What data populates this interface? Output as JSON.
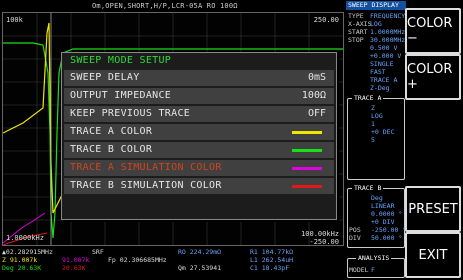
{
  "topbar": {
    "title": "Om,OPEN,SHORT,H/P,LCR-05A  RO 100Ω"
  },
  "plot": {
    "y_top_left": "100k",
    "y_top_right": "250.00",
    "y_bottom_left": "1.0000kHz",
    "y_bottom_right_1": "100.00kHz",
    "y_bottom_right_2": "-250.00"
  },
  "readout": {
    "line1_a": "▲02.282915MHz",
    "line1_b": "SRF",
    "line1_c": "RO 224.29mΩ",
    "line1_d": "R1 104.77kΩ",
    "line2_a": "Z  91.007k",
    "line2_b": "91.007k",
    "line2_c": "Fp 02.306685MHz",
    "line2_d": "L1 262.54uH",
    "line3_a": "Deg  20.63K",
    "line3_b": "20.63K",
    "line3_c": "Qm 27.53941",
    "line3_d": "C1 18.43pF"
  },
  "info": {
    "header": "SWEEP DISPLAY",
    "rows": [
      {
        "k": "TYPE",
        "v": "FREQUENCY"
      },
      {
        "k": "X-AXIS",
        "v": "LOG"
      },
      {
        "k": "START",
        "v": "1.0000MHz"
      },
      {
        "k": "STOP",
        "v": "30.000MHz"
      },
      {
        "k": "",
        "v": "0.500 V"
      },
      {
        "k": "",
        "v": "+0.000 V"
      },
      {
        "k": "",
        "v": "SINGLE"
      },
      {
        "k": "",
        "v": "FAST"
      },
      {
        "k": "",
        "v": "TRACE A"
      },
      {
        "k": "",
        "v": "Z-Deg"
      }
    ],
    "trace_a_label": "TRACE A",
    "trace_a_rows": [
      {
        "k": "",
        "v": "Z"
      },
      {
        "k": "",
        "v": "LOG"
      },
      {
        "k": "",
        "v": "1"
      },
      {
        "k": "",
        "v": "+0 DEC"
      },
      {
        "k": "",
        "v": "5"
      }
    ],
    "trace_b_label": "TRACE B",
    "trace_b_rows": [
      {
        "k": "",
        "v": "Deg"
      },
      {
        "k": "",
        "v": "LINEAR"
      },
      {
        "k": "",
        "v": "0.0000 °"
      },
      {
        "k": "",
        "v": "+0 DIV"
      },
      {
        "k": "POS",
        "v": "-250.00 °"
      },
      {
        "k": "DIV",
        "v": "50.000 °"
      }
    ],
    "analysis_label": "ANALYSIS",
    "analysis_row": {
      "k": "MODEL",
      "v": "F"
    }
  },
  "softkeys": [
    {
      "label": "COLOR −"
    },
    {
      "label": "COLOR +"
    },
    {
      "label": ""
    },
    {
      "label": "PRESET"
    },
    {
      "label": "EXIT"
    }
  ],
  "dialog": {
    "title": "SWEEP MODE SETUP",
    "items": [
      {
        "label": "SWEEP DELAY",
        "value": "0mS"
      },
      {
        "label": "OUTPUT IMPEDANCE",
        "value": "100Ω"
      },
      {
        "label": "KEEP PREVIOUS TRACE",
        "value": "OFF"
      },
      {
        "label": "TRACE A COLOR",
        "color": "#f2e600"
      },
      {
        "label": "TRACE B COLOR",
        "color": "#18e018"
      },
      {
        "label": "TRACE A SIMULATION COLOR",
        "color": "#e000e0",
        "selected": true
      },
      {
        "label": "TRACE B SIMULATION COLOR",
        "color": "#e01818"
      }
    ]
  },
  "colors": {
    "trace_a": "#f2e600",
    "trace_b": "#18e018",
    "selected_text": "#d0431f",
    "info_value": "#6aa6ff",
    "header_bg": "#1450a0"
  }
}
